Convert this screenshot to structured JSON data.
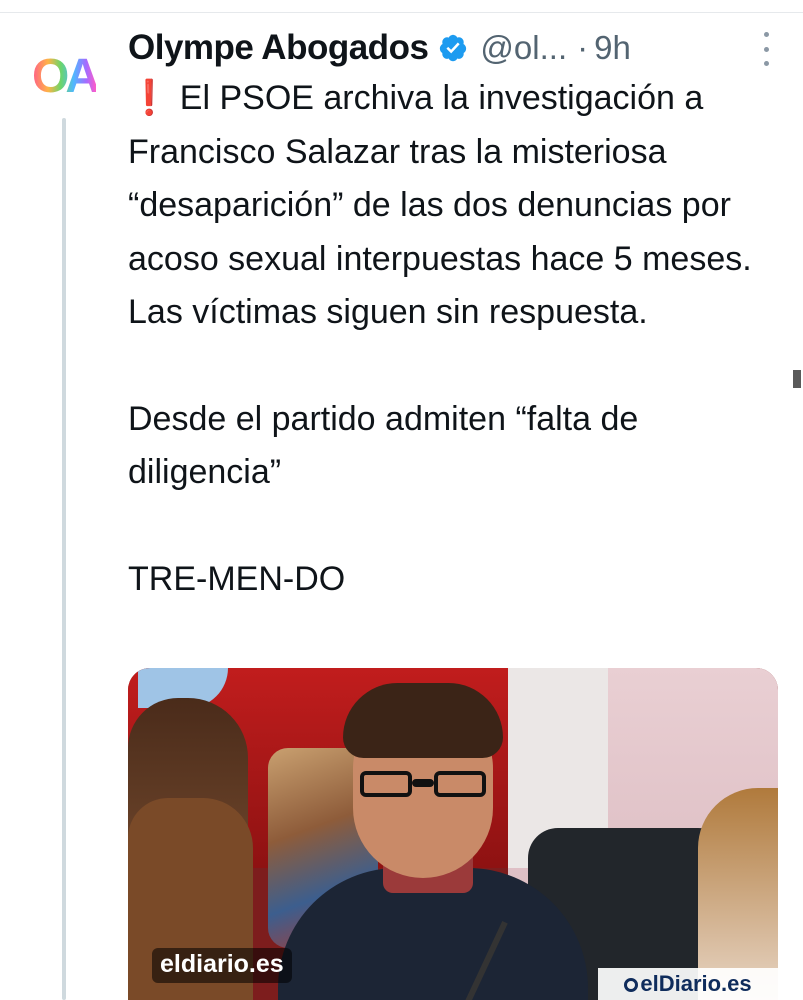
{
  "author": {
    "display_name": "Olympe Abogados",
    "handle": "@ol...",
    "separator": "·",
    "time": "9h",
    "avatar_text": "OA",
    "verified": true
  },
  "tweet": {
    "emoji": "❗",
    "paragraphs": [
      "El PSOE archiva la investigación a Francisco Salazar tras la misteriosa “desaparición” de las dos denuncias por acoso sexual interpuestas hace 5 meses. Las víctimas siguen sin respuesta.",
      "Desde el partido admiten “falta de diligencia”",
      "TRE-MEN-DO"
    ]
  },
  "media": {
    "source_label": "eldiario.es",
    "brand_label": "elDiario.es"
  },
  "colors": {
    "text": "#0f1419",
    "secondary": "#536471",
    "verified_blue": "#1d9bf0"
  }
}
